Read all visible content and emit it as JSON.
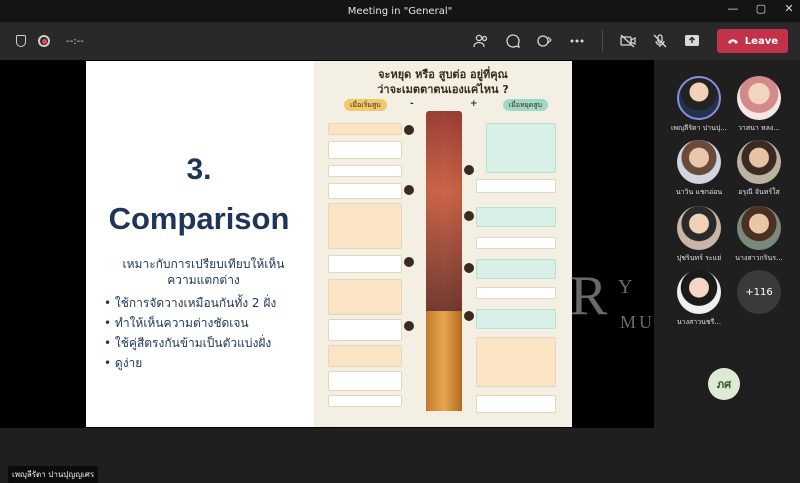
{
  "window": {
    "title": "Meeting in \"General\"",
    "controls": [
      "—",
      "▢",
      "✕"
    ]
  },
  "toolbar": {
    "timer": "--:--",
    "leave_label": "Leave",
    "icons": [
      "people-icon",
      "chat-icon",
      "reactions-icon",
      "more-icon",
      "camera-off-icon",
      "mic-off-icon",
      "share-icon"
    ]
  },
  "slide": {
    "number": "3.",
    "heading": "Comparison",
    "subtitle": "เหมาะกับการเปรียบเทียบให้เห็นความแตกต่าง",
    "bullets": [
      "ใช้การจัดวางเหมือนกันทั้ง 2 ฝั่ง",
      "ทำให้เห็นความต่างชัดเจน",
      "ใช้คู่สีตรงกันข้ามเป็นตัวแบ่งฝั่ง",
      "ดูง่าย"
    ],
    "infographic": {
      "title_line1": "จะหยุด หรือ สูบต่อ อยู่ที่คุณ",
      "title_line2": "ว่าจะเมตตาตนเองแค่ไหน ?",
      "left_label": "เมื่อเริ่มสูบ",
      "right_label": "เมื่อหยุดสูบ",
      "minus": "-",
      "plus": "+"
    }
  },
  "watermark": {
    "r": "R",
    "y": "Y",
    "mutt": "MUTT"
  },
  "stage": {
    "presenter_name": "เพญุลีรัตา ปานปุญญเศร"
  },
  "participants": [
    {
      "name": "เพญุลีรัตา ปานปุ..."
    },
    {
      "name": "วาสนา หลง..."
    },
    {
      "name": "นาวิน แชกอ่อน"
    },
    {
      "name": "อรุณี จันทร์ใส"
    },
    {
      "name": "ปุชรินทร์ ระแย่"
    },
    {
      "name": "นางสาวกรินร..."
    },
    {
      "name": "นางสาวนชรี..."
    }
  ],
  "more_count": "+116",
  "self_initials": "ภศ"
}
